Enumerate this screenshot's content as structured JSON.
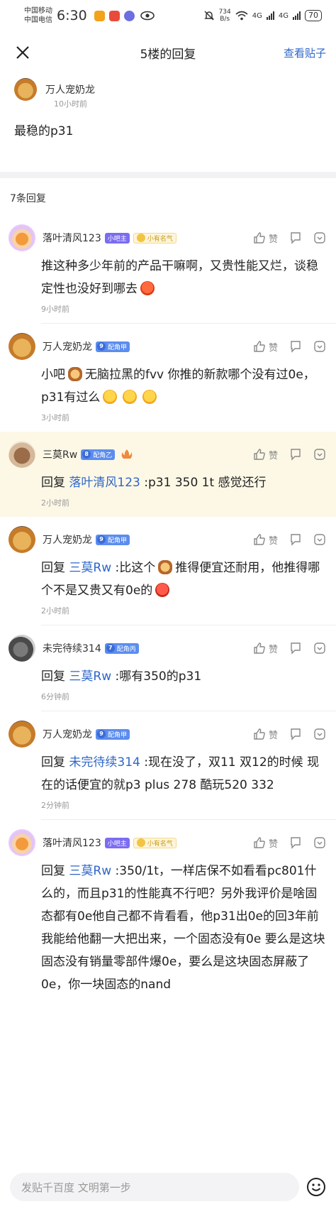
{
  "status_bar": {
    "carrier_1": "中国移动",
    "carrier_2": "中国电信",
    "time": "6:30",
    "speed_value": "734",
    "speed_unit": "B/s",
    "network_1": "4G",
    "network_2": "4G",
    "battery": "70"
  },
  "nav": {
    "title": "5楼的回复",
    "view_post": "查看贴子"
  },
  "post": {
    "author": "万人宠奶龙",
    "time": "10小时前",
    "content": "最稳的p31"
  },
  "reply_count": "7条回复",
  "like_label": "赞",
  "replies": [
    {
      "user": "落叶清风123",
      "badge_host": "小吧主",
      "badge_fame": "小有名气",
      "text": "推这种多少年前的产品干嘛啊，又贵性能又烂，谈稳定性也没好到哪去",
      "time": "9小时前"
    },
    {
      "user": "万人宠奶龙",
      "badge_level": "9",
      "badge_role": "配角甲",
      "text_before": "小吧",
      "text_after": "无脑拉黑的fvv 你推的新款哪个没有过0e，p31有过么",
      "time": "3小时前"
    },
    {
      "user": "三莫Rw",
      "badge_level": "8",
      "badge_role": "配角乙",
      "prefix": "回复",
      "target": "落叶清风123",
      "text": ":p31 350 1t 感觉还行",
      "time": "2小时前"
    },
    {
      "user": "万人宠奶龙",
      "badge_level": "9",
      "badge_role": "配角甲",
      "prefix": "回复",
      "target": "三莫Rw",
      "text_before": ":比这个",
      "text_after": "推得便宜还耐用，他推得哪个不是又贵又有0e的",
      "time": "2小时前"
    },
    {
      "user": "未完待续314",
      "badge_level": "7",
      "badge_role": "配角丙",
      "prefix": "回复",
      "target": "三莫Rw",
      "text": ":哪有350的p31",
      "time": "6分钟前"
    },
    {
      "user": "万人宠奶龙",
      "badge_level": "9",
      "badge_role": "配角甲",
      "prefix": "回复",
      "target": "未完待续314",
      "text": ":现在没了，双11 双12的时候 现在的话便宜的就p3 plus 278 酷玩520 332",
      "time": "2分钟前"
    },
    {
      "user": "落叶清风123",
      "badge_host": "小吧主",
      "badge_fame": "小有名气",
      "prefix": "回复",
      "target": "三莫Rw",
      "text": ":350/1t，一样店保不如看看pc801什么的，而且p31的性能真不行吧？另外我评价是啥固态都有0e他自己都不肯看看，他p31出0e的回3年前我能给他翻一大把出来，一个固态没有0e 要么是这块固态没有销量零部件爆0e，要么是这块固态屏蔽了0e，你一块固态的nand"
    }
  ],
  "composer": {
    "placeholder": "发贴千百度 文明第一步"
  },
  "colors": {
    "link": "#2f66c8",
    "highlight_bg": "#fdf8e6",
    "host_badge": "#7c6cf0",
    "level_badge": "#5b8def"
  }
}
